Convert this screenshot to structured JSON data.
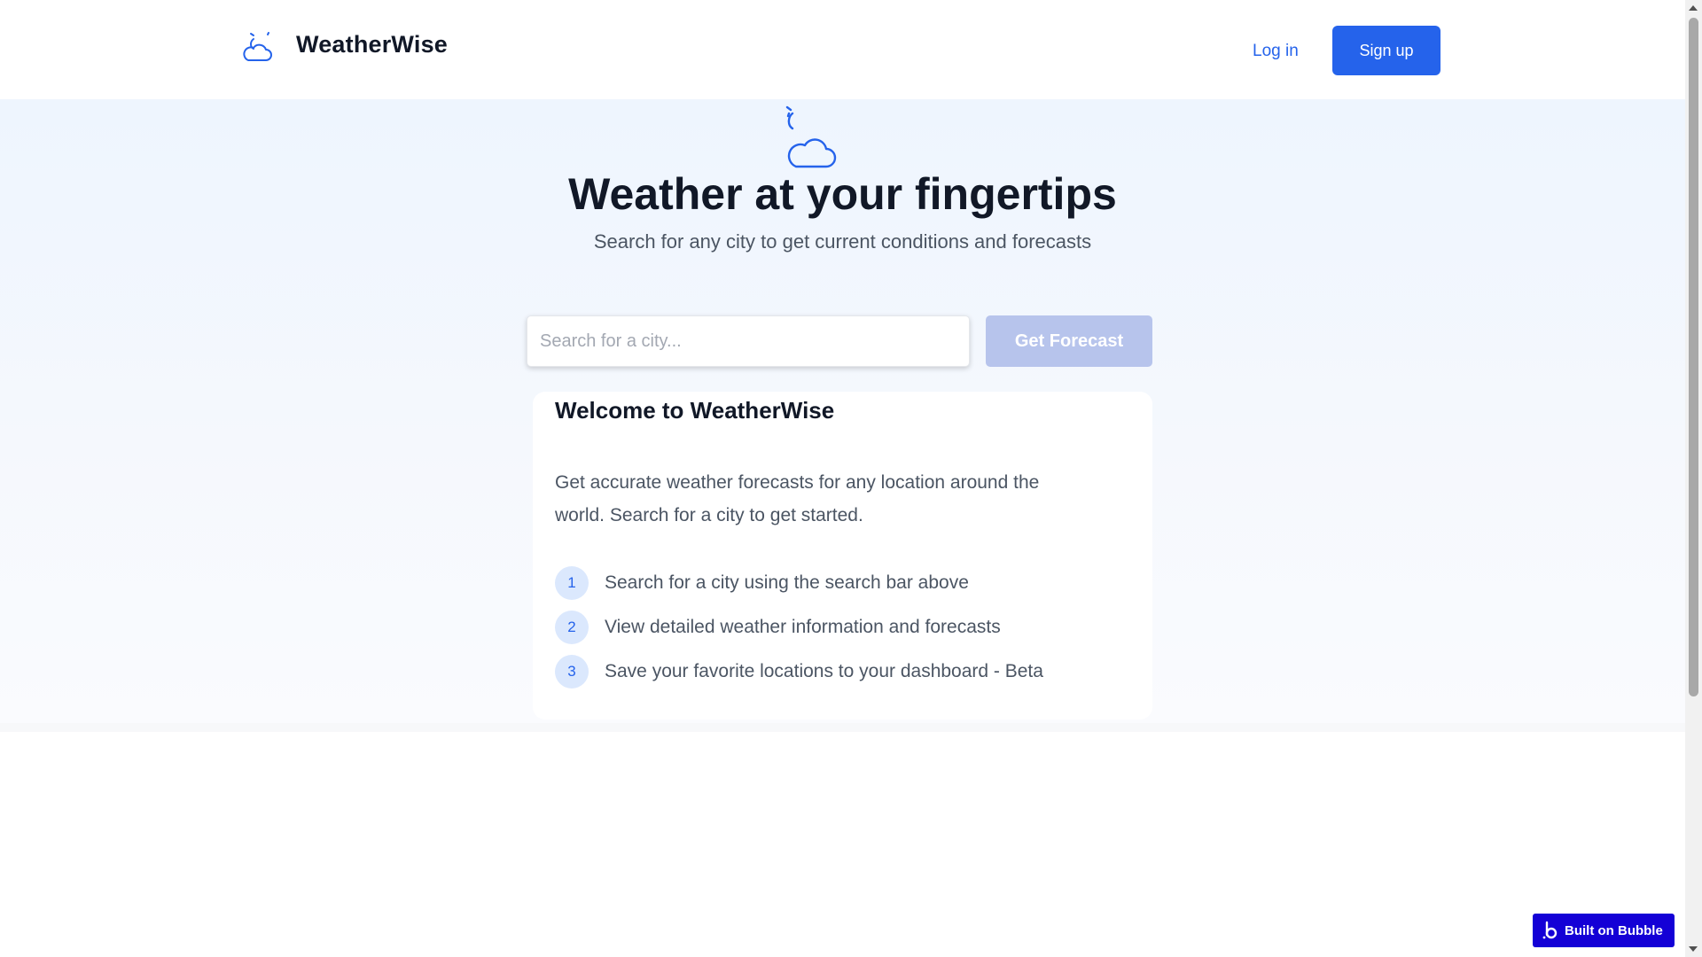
{
  "header": {
    "brand_name": "WeatherWise",
    "brand_icon": "cloud-moon-icon",
    "login_label": "Log in",
    "signup_label": "Sign up"
  },
  "hero": {
    "icon": "cloud-moon-icon",
    "title": "Weather at your fingertips",
    "subtitle": "Search for any city to get current conditions and forecasts"
  },
  "search": {
    "placeholder": "Search for a city...",
    "value": "",
    "button_label": "Get Forecast"
  },
  "welcome": {
    "title": "Welcome to WeatherWise",
    "description": "Get accurate weather forecasts for any location around the world. Search for a city to get started.",
    "steps": [
      {
        "number": "1",
        "text": "Search for a city using the search bar above"
      },
      {
        "number": "2",
        "text": "View detailed weather information and forecasts"
      },
      {
        "number": "3",
        "text": "Save your favorite locations to your dashboard - Beta"
      }
    ]
  },
  "badge": {
    "label": "Built on Bubble",
    "icon": "bubble-logo-icon"
  },
  "colors": {
    "accent": "#2563eb",
    "forecast_button_disabled": "#b7c4ec",
    "step_badge_bg": "#dbe8fd",
    "bubble_badge": "#1400d6"
  }
}
